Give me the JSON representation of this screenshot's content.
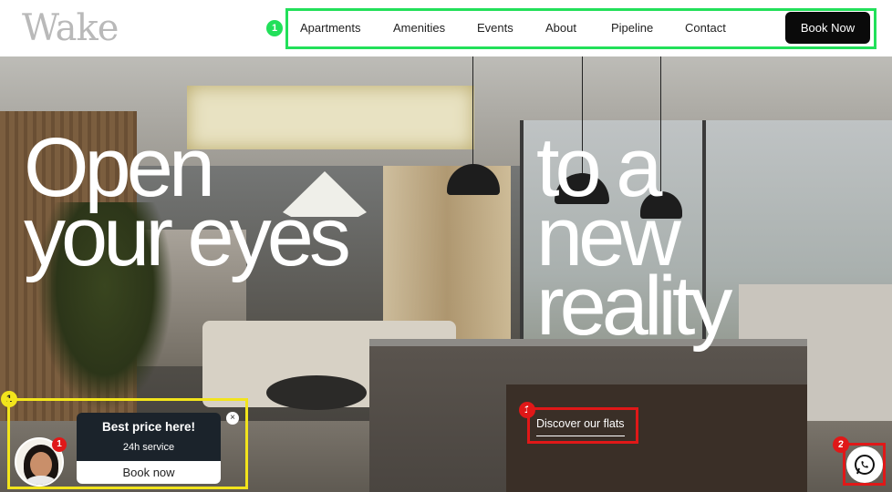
{
  "brand": {
    "logo_text": "Wake"
  },
  "nav": {
    "badge": "1",
    "items": [
      "Apartments",
      "Amenities",
      "Events",
      "About",
      "Pipeline",
      "Contact"
    ],
    "cta": "Book Now"
  },
  "hero": {
    "headline_left": [
      "Open",
      "your eyes"
    ],
    "headline_right": [
      "to a",
      "new",
      "reality"
    ],
    "discover_link": "Discover our flats",
    "discover_badge": "1"
  },
  "chat_widget": {
    "badge": "1",
    "avatar_badge": "1",
    "title": "Best price here!",
    "subtitle": "24h service",
    "button": "Book now",
    "close": "×"
  },
  "whatsapp": {
    "badge": "2",
    "icon": "whatsapp-icon"
  }
}
